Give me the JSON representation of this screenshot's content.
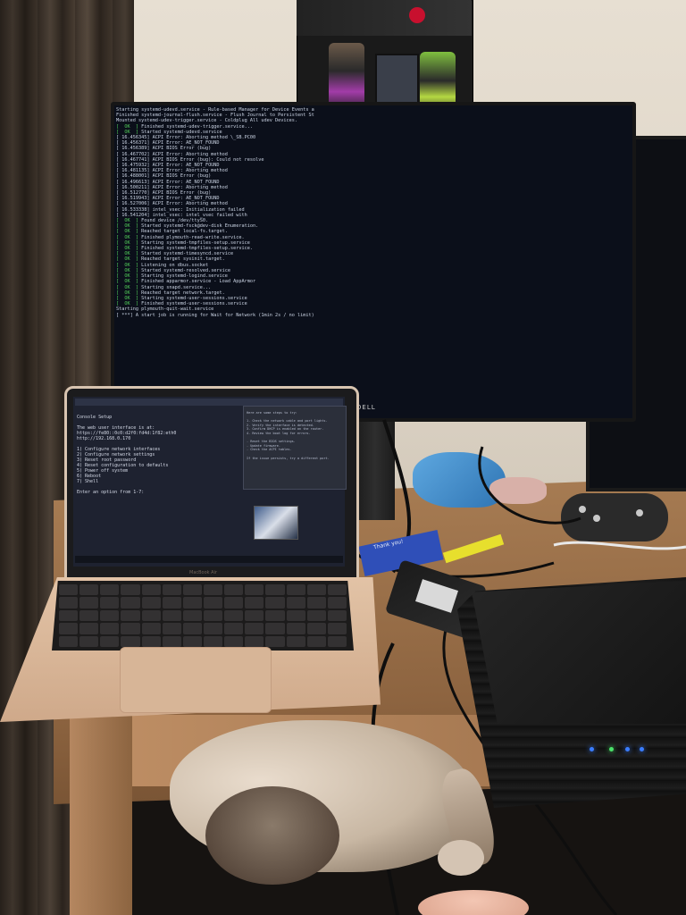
{
  "scene": {
    "description_label": "Desk setup with monitors, laptop, mini PC and sleeping cat"
  },
  "monitor_main": {
    "brand": "DELL",
    "boot_lines": [
      {
        "status": "",
        "text": "Starting systemd-udevd.service - Rule-based Manager for Device Events a"
      },
      {
        "status": "",
        "text": "Finished systemd-journal-flush.service - Flush Journal to Persistent St"
      },
      {
        "status": "",
        "text": "Mounted systemd-udev-trigger.service - Coldplug All udev Devices."
      },
      {
        "status": "  OK  ",
        "text": "Finished systemd-udev-trigger.service..."
      },
      {
        "status": "  OK  ",
        "text": "Started systemd-udevd.service"
      },
      {
        "status": "",
        "text": "[ 16.456345] ACPI Error: Aborting method \\_SB.PC00"
      },
      {
        "status": "",
        "text": "[ 16.456371] ACPI Error: AE_NOT_FOUND"
      },
      {
        "status": "",
        "text": "[ 16.456389] ACPI BIOS Error (bug)"
      },
      {
        "status": "",
        "text": "[ 16.467702] ACPI Error: Aborting method"
      },
      {
        "status": "",
        "text": "[ 16.467741] ACPI BIOS Error (bug): Could not resolve"
      },
      {
        "status": "",
        "text": "[ 16.475932] ACPI Error: AE_NOT_FOUND"
      },
      {
        "status": "",
        "text": "[ 16.481135] ACPI Error: Aborting method"
      },
      {
        "status": "",
        "text": "[ 16.488001] ACPI BIOS Error (bug)"
      },
      {
        "status": "",
        "text": "[ 16.496613] ACPI Error: AE_NOT_FOUND"
      },
      {
        "status": "",
        "text": "[ 16.500211] ACPI Error: Aborting method"
      },
      {
        "status": "",
        "text": "[ 16.512770] ACPI BIOS Error (bug)"
      },
      {
        "status": "",
        "text": "[ 16.519943] ACPI Error: AE_NOT_FOUND"
      },
      {
        "status": "",
        "text": "[ 16.527006] ACPI Error: Aborting method"
      },
      {
        "status": "",
        "text": "[ 16.533338] intel_vsec: Initialization failed"
      },
      {
        "status": "",
        "text": "[ 16.541204] intel_vsec: intel_vsec failed with"
      },
      {
        "status": "  OK  ",
        "text": "Found device /dev/ttyS0."
      },
      {
        "status": "  OK  ",
        "text": "Started systemd-fsck@dev-disk Enumeration."
      },
      {
        "status": "  OK  ",
        "text": "Reached target local-fs.target."
      },
      {
        "status": "  OK  ",
        "text": "Finished plymouth-read-write.service."
      },
      {
        "status": "  OK  ",
        "text": "Starting systemd-tmpfiles-setup.service"
      },
      {
        "status": "  OK  ",
        "text": "Finished systemd-tmpfiles-setup.service."
      },
      {
        "status": "  OK  ",
        "text": "Started systemd-timesyncd.service"
      },
      {
        "status": "  OK  ",
        "text": "Reached target sysinit.target."
      },
      {
        "status": "  OK  ",
        "text": "Listening on dbus.socket"
      },
      {
        "status": "  OK  ",
        "text": "Started systemd-resolved.service"
      },
      {
        "status": "  OK  ",
        "text": "Starting systemd-logind.service"
      },
      {
        "status": "  OK  ",
        "text": "Finished apparmor.service - Load AppArmor"
      },
      {
        "status": "  OK  ",
        "text": "Starting snapd.service..."
      },
      {
        "status": "  OK  ",
        "text": "Reached target network.target."
      },
      {
        "status": "  OK  ",
        "text": "Starting systemd-user-sessions.service"
      },
      {
        "status": "  OK  ",
        "text": "Finished systemd-user-sessions.service"
      },
      {
        "status": "",
        "text": "Starting plymouth-quit-wait.service"
      },
      {
        "status": "",
        "text": "[ ***] A start job is running for Wait for Network (1min 2s / no limit)"
      }
    ]
  },
  "laptop": {
    "brand": "MacBook Air",
    "terminal_lines": [
      "Console Setup",
      "",
      "The web user interface is at:",
      "https://fe80::0c0:d2f0:fd4d:1f82:eth0",
      "http://192.168.0.170",
      "",
      "1) Configure network interfaces",
      "2) Configure network settings",
      "3) Reset root password",
      "4) Reset configuration to defaults",
      "5) Power off system",
      "6) Reboot",
      "7) Shell",
      "",
      "Enter an option from 1-7: "
    ],
    "chat_lines": [
      "Here are some steps to try:",
      "",
      "1. Check the network cable and port lights.",
      "2. Verify the interface is detected.",
      "3. Confirm DHCP is enabled on the router.",
      "4. Review the boot log for errors.",
      "",
      "- Reset the BIOS settings.",
      "- Update firmware.",
      "- Check the ACPI tables.",
      "",
      "If the issue persists, try a different port."
    ]
  },
  "accessories": {
    "card_text": "Thank you!"
  }
}
